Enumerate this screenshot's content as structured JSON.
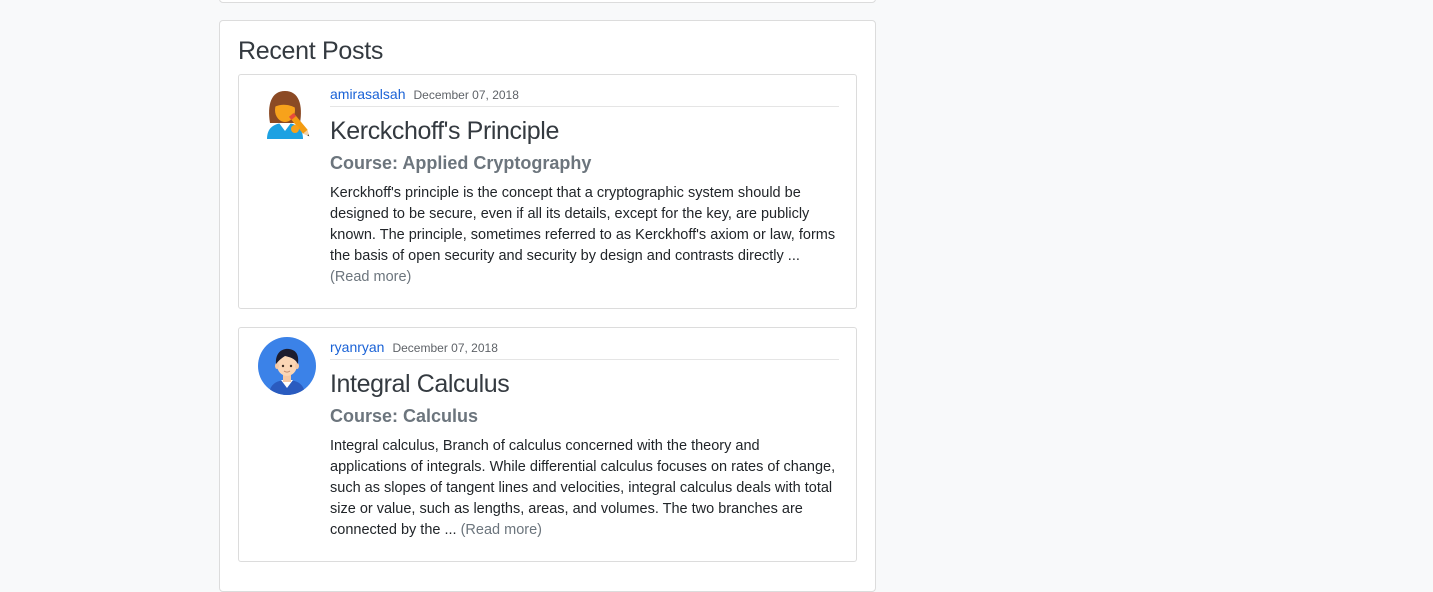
{
  "recent_posts": {
    "title": "Recent Posts",
    "posts": [
      {
        "author": "amirasalsah",
        "date": "December 07, 2018",
        "title": "Kerckchoff's Principle",
        "course": "Course: Applied Cryptography",
        "excerpt": "Kerckhoff's principle is the concept that a cryptographic system should be designed to be secure, even if all its details, except for the key, are publicly known. The principle, sometimes referred to as Kerckhoff's axiom or law, forms the basis of open security and security by design and contrasts directly ... ",
        "read_more": "(Read more)",
        "avatar_icon": "woman-writer-avatar-icon"
      },
      {
        "author": "ryanryan",
        "date": "December 07, 2018",
        "title": "Integral Calculus",
        "course": "Course: Calculus",
        "excerpt": "Integral calculus, Branch of calculus concerned with the theory and applications of integrals. While differential calculus focuses on rates of change, such as slopes of tangent lines and velocities, integral calculus deals with total size or value, such as lengths, areas, and volumes. The two branches are connected by the ... ",
        "read_more": "(Read more)",
        "avatar_icon": "man-avatar-icon"
      }
    ]
  },
  "colors": {
    "link": "#1a62d6",
    "muted": "#6c757d",
    "heading": "#343a40",
    "border": "#dcdcdc"
  }
}
